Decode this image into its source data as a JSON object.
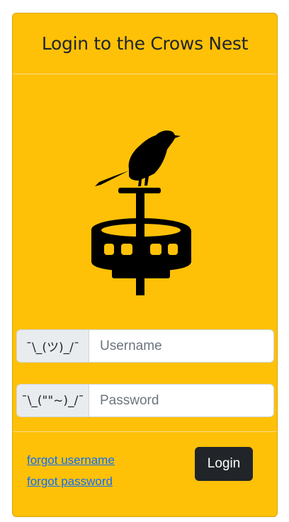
{
  "header": {
    "title": "Login to the Crows Nest"
  },
  "logo": {
    "icon": "crow-on-crows-nest-icon",
    "fill": "#000000"
  },
  "username": {
    "addon": "¯\\_(ツ)_/¯",
    "placeholder": "Username",
    "value": ""
  },
  "password": {
    "addon": "¯\\_(\"\"~)_/¯",
    "placeholder": "Password",
    "value": ""
  },
  "footer": {
    "forgot_username": "forgot username",
    "forgot_password": "forgot password",
    "login_label": "Login"
  },
  "colors": {
    "card_background": "#ffc107",
    "link": "#0d6efd",
    "button": "#212529",
    "addon_background": "#e9ecef"
  }
}
